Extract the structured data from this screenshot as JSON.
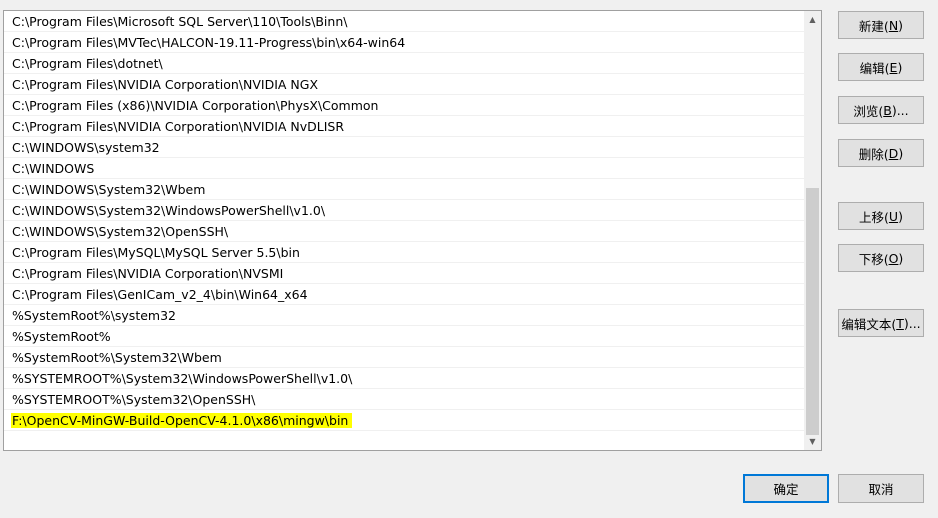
{
  "path_list": [
    "C:\\Program Files\\Microsoft SQL Server\\110\\Tools\\Binn\\",
    "C:\\Program Files\\MVTec\\HALCON-19.11-Progress\\bin\\x64-win64",
    "C:\\Program Files\\dotnet\\",
    "C:\\Program Files\\NVIDIA Corporation\\NVIDIA NGX",
    "C:\\Program Files (x86)\\NVIDIA Corporation\\PhysX\\Common",
    "C:\\Program Files\\NVIDIA Corporation\\NVIDIA NvDLISR",
    "C:\\WINDOWS\\system32",
    "C:\\WINDOWS",
    "C:\\WINDOWS\\System32\\Wbem",
    "C:\\WINDOWS\\System32\\WindowsPowerShell\\v1.0\\",
    "C:\\WINDOWS\\System32\\OpenSSH\\",
    "C:\\Program Files\\MySQL\\MySQL Server 5.5\\bin",
    "C:\\Program Files\\NVIDIA Corporation\\NVSMI",
    "C:\\Program Files\\GenICam_v2_4\\bin\\Win64_x64",
    "%SystemRoot%\\system32",
    "%SystemRoot%",
    "%SystemRoot%\\System32\\Wbem",
    "%SYSTEMROOT%\\System32\\WindowsPowerShell\\v1.0\\",
    "%SYSTEMROOT%\\System32\\OpenSSH\\",
    "F:\\OpenCV-MinGW-Build-OpenCV-4.1.0\\x86\\mingw\\bin"
  ],
  "selected_index": 19,
  "selection_color": "#ffff00",
  "buttons": {
    "new": {
      "label": "新建(",
      "key": "N",
      "close": ")"
    },
    "edit": {
      "label": "编辑(",
      "key": "E",
      "close": ")"
    },
    "browse": {
      "label": "浏览(",
      "key": "B",
      "close": ")..."
    },
    "delete": {
      "label": "删除(",
      "key": "D",
      "close": ")"
    },
    "move_up": {
      "label": "上移(",
      "key": "U",
      "close": ")"
    },
    "move_down": {
      "label": "下移(",
      "key": "O",
      "close": ")"
    },
    "edit_text": {
      "label": "编辑文本(",
      "key": "T",
      "close": ")..."
    },
    "ok": "确定",
    "cancel": "取消"
  },
  "icons": {
    "scroll_up": "▲",
    "scroll_down": "▼"
  }
}
